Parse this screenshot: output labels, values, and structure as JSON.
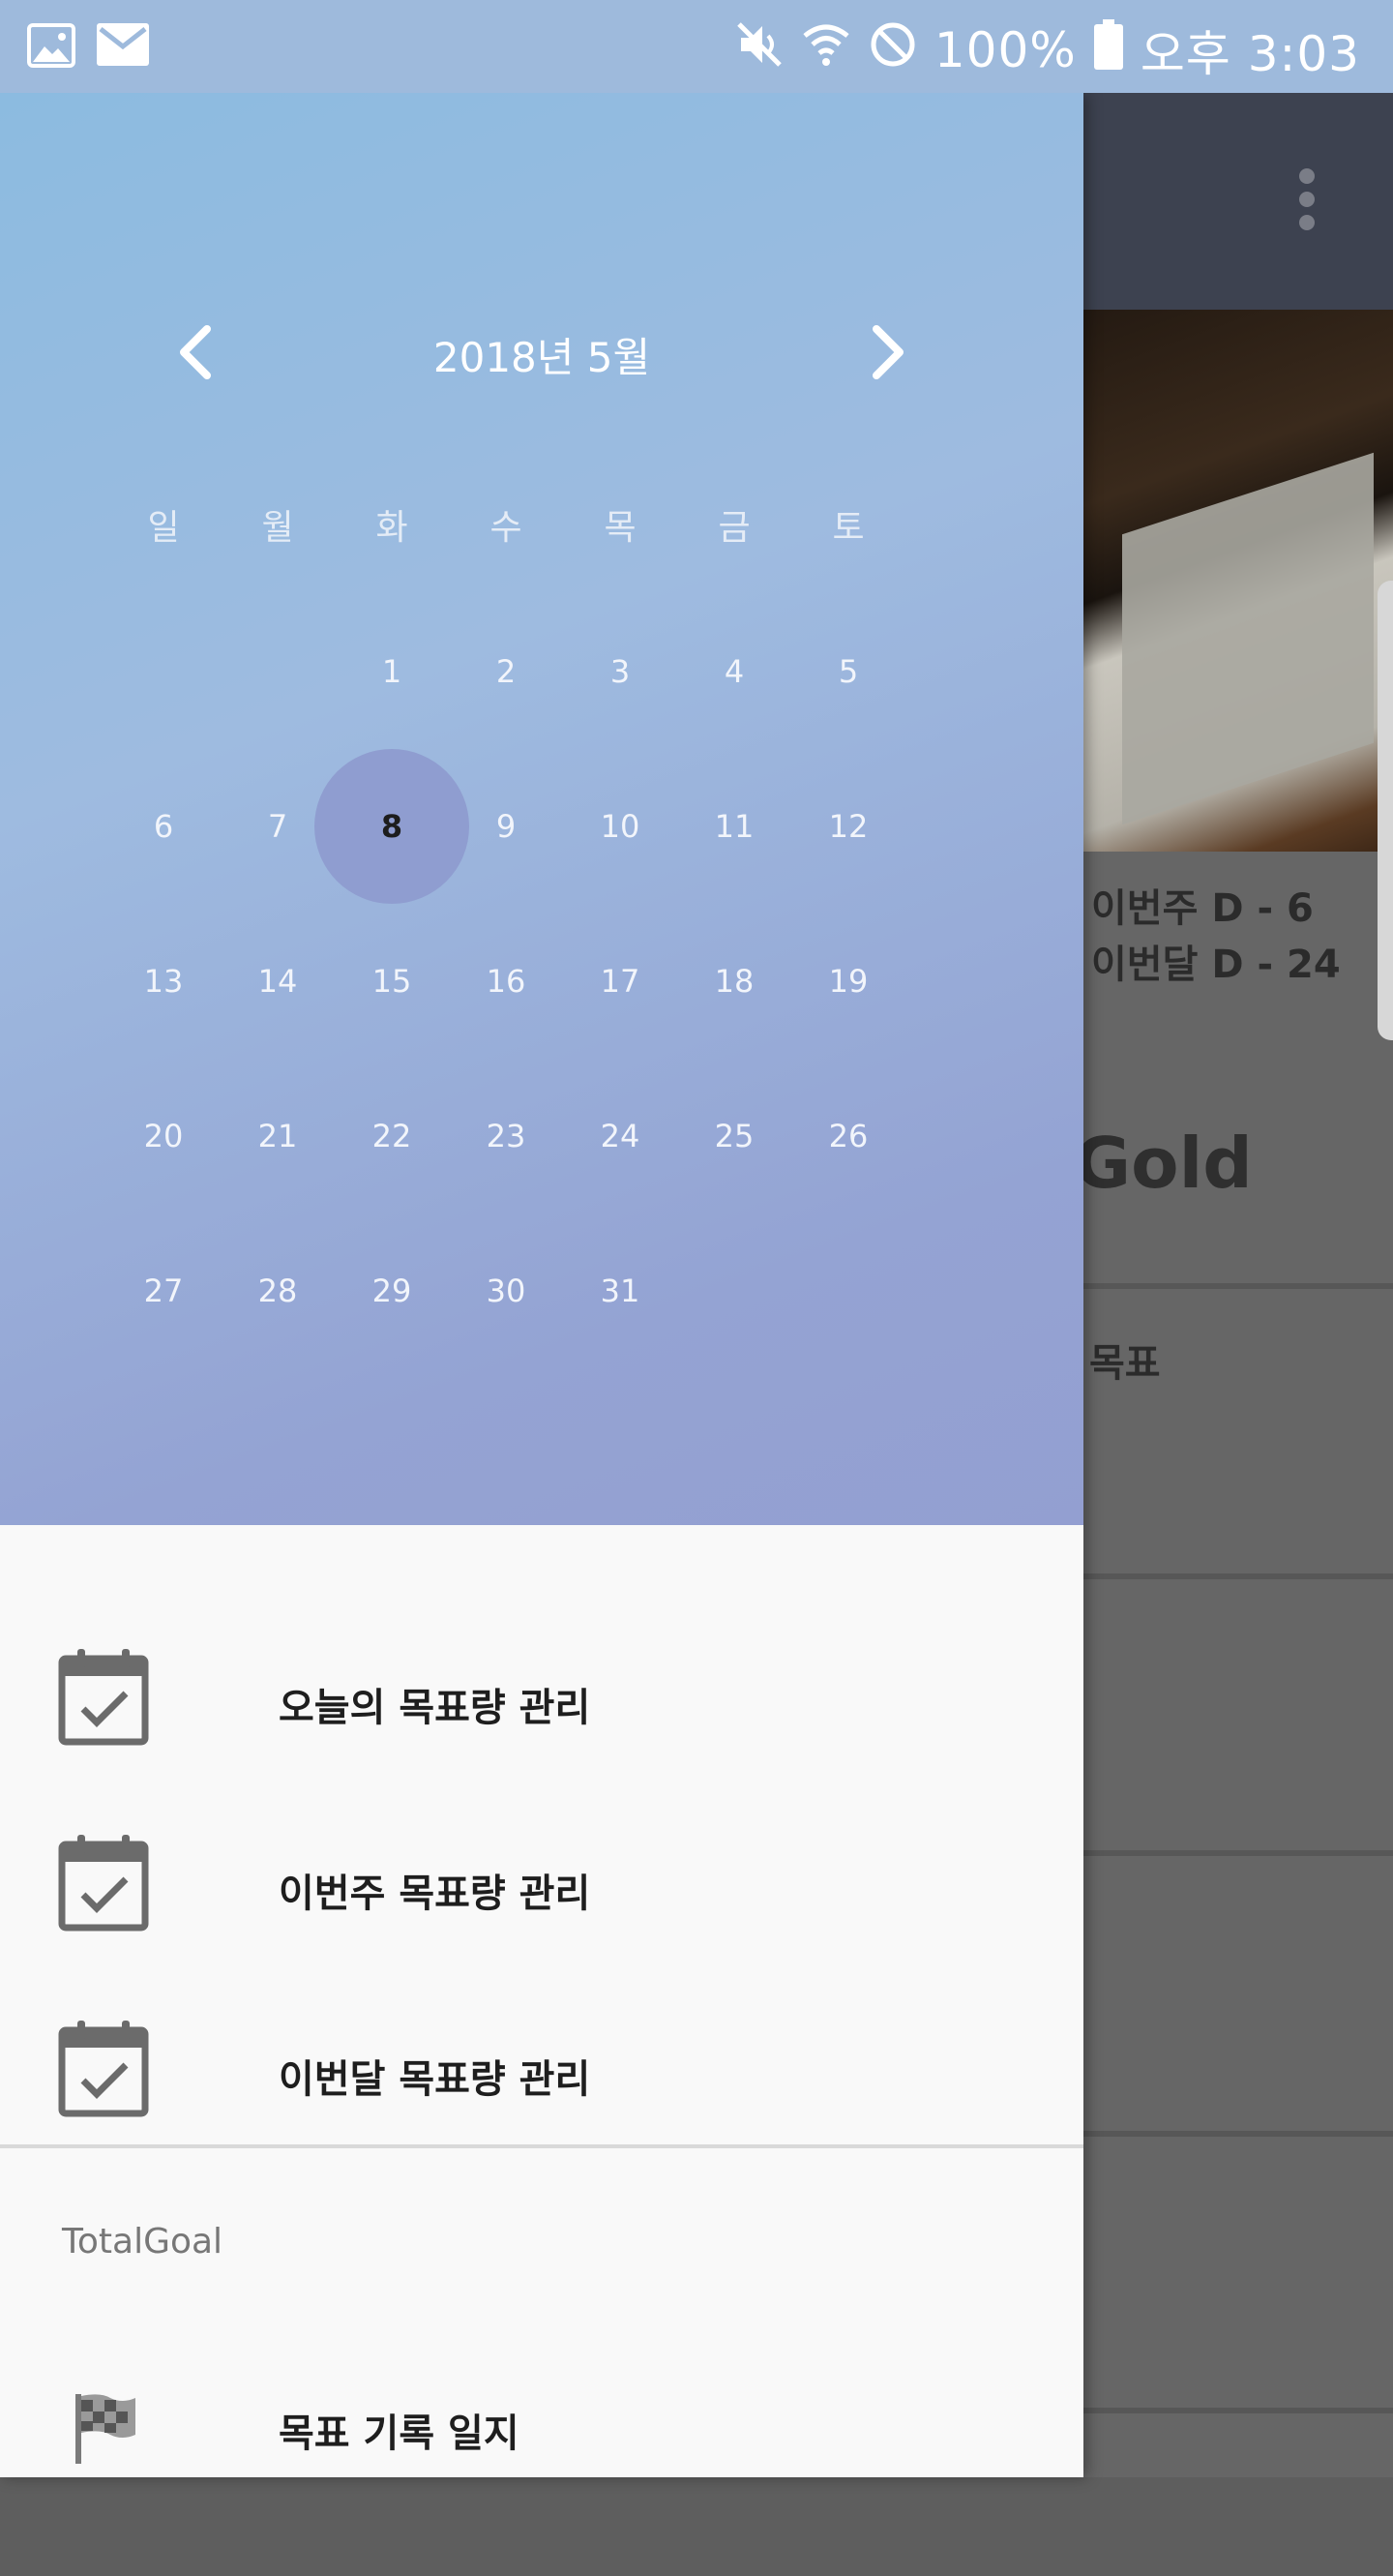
{
  "status_bar": {
    "battery": "100%",
    "time": "오후 3:03",
    "icons": [
      "image-icon",
      "mail-icon",
      "mute-icon",
      "wifi-icon",
      "do-not-disturb-icon",
      "battery-icon"
    ]
  },
  "background_app": {
    "dday_week": "이번주  D - 6",
    "dday_month": "이번달  D - 24",
    "gold_partial": "Gold",
    "goal_partial": "목표"
  },
  "calendar": {
    "title": "2018년 5월",
    "weekdays": [
      "일",
      "월",
      "화",
      "수",
      "목",
      "금",
      "토"
    ],
    "weeks": [
      [
        "",
        "",
        "1",
        "2",
        "3",
        "4",
        "5"
      ],
      [
        "6",
        "7",
        "8",
        "9",
        "10",
        "11",
        "12"
      ],
      [
        "13",
        "14",
        "15",
        "16",
        "17",
        "18",
        "19"
      ],
      [
        "20",
        "21",
        "22",
        "23",
        "24",
        "25",
        "26"
      ],
      [
        "27",
        "28",
        "29",
        "30",
        "31",
        "",
        ""
      ]
    ],
    "selected_day": "8"
  },
  "menu": {
    "items": [
      {
        "label": "오늘의 목표량 관리",
        "icon": "calendar-check-icon"
      },
      {
        "label": "이번주 목표량 관리",
        "icon": "calendar-check-icon"
      },
      {
        "label": "이번달 목표량 관리",
        "icon": "calendar-check-icon"
      }
    ],
    "section_title": "TotalGoal",
    "section_items": [
      {
        "label": "목표 기록 일지",
        "icon": "checkered-flag-icon"
      }
    ]
  },
  "colors": {
    "calendar_gradient_start": "#8cbbe0",
    "calendar_gradient_end": "#939fd1",
    "selected_day_circle": "#8f9dd0",
    "toolbar": "#3d4250",
    "drawer_background": "#f9f9f9"
  }
}
